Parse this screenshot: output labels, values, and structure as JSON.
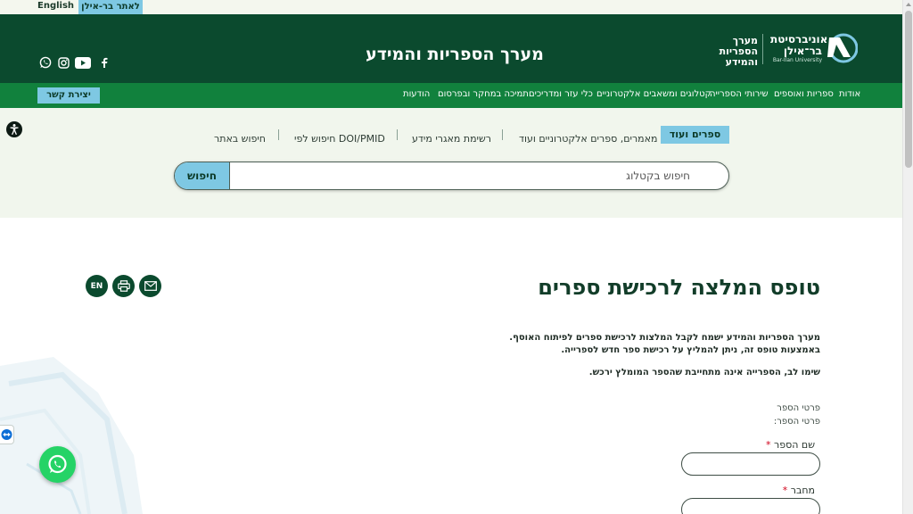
{
  "topbar": {
    "english_label": "English",
    "main_site_label": "לאתר בר-אילן"
  },
  "header": {
    "university_name_he": "אוניברסיטת בר־אילן",
    "university_name_en": "Bar-Ilan University",
    "library_logo_text": "מערך הספריות והמידע",
    "site_title": "מערך הספריות והמידע",
    "social_icons": [
      "facebook-icon",
      "youtube-icon",
      "instagram-icon",
      "whatsapp-icon"
    ]
  },
  "nav": {
    "items": [
      "אודות",
      "ספריות ואוספים",
      "שירותי הספרייה",
      "קטלוגים ומשאבים אלקטרוניים",
      "כלי עזר ומדריכים",
      "תמיכה במחקר ובפרסום",
      "הודעות"
    ],
    "contact_label": "יצירת קשר"
  },
  "search": {
    "tabs": [
      "ספרים ועוד",
      "מאמרים, ספרים אלקטרוניים ועוד",
      "רשימת מאגרי מידע",
      "חיפוש לפי DOI/PMID",
      "חיפוש באתר"
    ],
    "active_tab": "ספרים ועוד",
    "placeholder": "חיפוש בקטלוג",
    "button_label": "חיפוש"
  },
  "page": {
    "title": "טופס המלצה לרכישת ספרים",
    "intro_lines": [
      "מערך הספריות והמידע ישמח לקבל המלצות לרכישת ספרים לפיתוח האוסף.",
      "באמצעות טופס זה, ניתן להמליץ על רכישת ספר חדש לספרייה."
    ],
    "note": "שימו לב, הספרייה אינה מתחייבת שהספר המומלץ ירכש.",
    "action_buttons": {
      "lang": "EN"
    },
    "section_labels": [
      "פרטי הספר",
      "פרטי הספר:"
    ],
    "fields": [
      {
        "label": "שם הספר",
        "required_mark": "*",
        "value": ""
      },
      {
        "label": "מחבר",
        "required_mark": "*",
        "value": ""
      }
    ]
  },
  "colors": {
    "header_green": "#0b4a2e",
    "nav_green": "#11813d",
    "accent_blue": "#7ec8e3",
    "search_bg": "#f1f6ed"
  }
}
